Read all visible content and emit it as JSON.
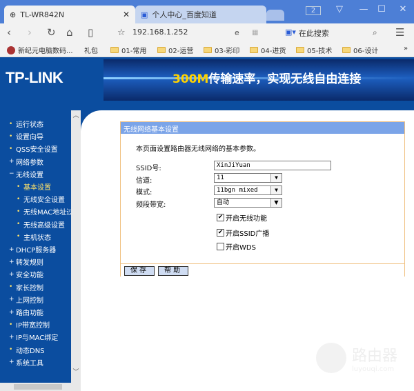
{
  "browser": {
    "tabs": [
      {
        "title": "TL-WR842N",
        "icon": "globe-icon"
      },
      {
        "title": "个人中心_百度知道",
        "icon": "baidu-paw-icon"
      }
    ],
    "tab_count": "2",
    "address": "192.168.1.252",
    "search_placeholder": "在此搜索",
    "bookmarks": [
      "新纪元电脑数码...",
      "礼包",
      "01-常用",
      "02-运营",
      "03-彩印",
      "04-进货",
      "05-技术",
      "06-设计"
    ],
    "more": "»"
  },
  "banner": {
    "logo": "TP-LINK",
    "slogan_highlight": "300M",
    "slogan": "传输速率，实现无线自由连接"
  },
  "sidebar": {
    "items": [
      {
        "label": "运行状态",
        "marker": "•",
        "level": 0
      },
      {
        "label": "设置向导",
        "marker": "•",
        "level": 0
      },
      {
        "label": "QSS安全设置",
        "marker": "•",
        "level": 0
      },
      {
        "label": "网络参数",
        "marker": "+",
        "level": 0
      },
      {
        "label": "无线设置",
        "marker": "−",
        "level": 0
      },
      {
        "label": "基本设置",
        "marker": "•",
        "level": 1,
        "active": true
      },
      {
        "label": "无线安全设置",
        "marker": "•",
        "level": 1
      },
      {
        "label": "无线MAC地址过滤",
        "marker": "•",
        "level": 1
      },
      {
        "label": "无线高级设置",
        "marker": "•",
        "level": 1
      },
      {
        "label": "主机状态",
        "marker": "•",
        "level": 1
      },
      {
        "label": "DHCP服务器",
        "marker": "+",
        "level": 0
      },
      {
        "label": "转发规则",
        "marker": "+",
        "level": 0
      },
      {
        "label": "安全功能",
        "marker": "+",
        "level": 0
      },
      {
        "label": "家长控制",
        "marker": "•",
        "level": 0
      },
      {
        "label": "上网控制",
        "marker": "+",
        "level": 0
      },
      {
        "label": "路由功能",
        "marker": "+",
        "level": 0
      },
      {
        "label": "IP带宽控制",
        "marker": "•",
        "level": 0
      },
      {
        "label": "IP与MAC绑定",
        "marker": "+",
        "level": 0
      },
      {
        "label": "动态DNS",
        "marker": "•",
        "level": 0
      },
      {
        "label": "系统工具",
        "marker": "+",
        "level": 0
      }
    ]
  },
  "panel": {
    "title": "无线网络基本设置",
    "desc": "本页面设置路由器无线网络的基本参数。",
    "ssid_label": "SSID号:",
    "ssid": "XinJiYuan",
    "channel_label": "信道:",
    "channel": "11",
    "mode_label": "模式:",
    "mode": "11bgn mixed",
    "bw_label": "频段带宽:",
    "bw": "自动",
    "wireless_on": {
      "label": "开启无线功能",
      "checked": true
    },
    "ssid_broadcast": {
      "label": "开启SSID广播",
      "checked": true
    },
    "wds": {
      "label": "开启WDS",
      "checked": false
    },
    "save": "保存",
    "help": "帮助"
  },
  "watermark": {
    "name": "路由器",
    "url": "luyouqi.com"
  },
  "colors": {
    "nav_bg": "#0b4d9f",
    "panel_head": "#7ba4e8",
    "panel_border": "#f0c080",
    "active_nav": "#ffe36a"
  }
}
